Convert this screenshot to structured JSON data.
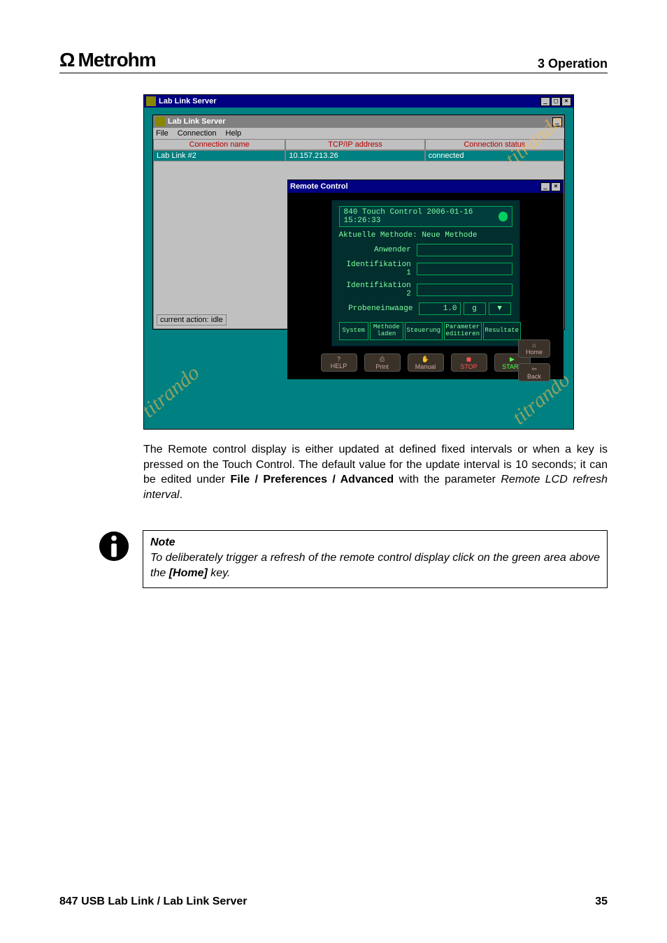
{
  "header": {
    "brand": "Metrohm",
    "section": "3 Operation"
  },
  "outer": {
    "title": "Lab Link Server"
  },
  "inner": {
    "title": "Lab Link Server",
    "menu": [
      "File",
      "Connection",
      "Help"
    ],
    "headers": [
      "Connection name",
      "TCP/IP address",
      "Connection status"
    ],
    "row": [
      "Lab Link #2",
      "10.157.213.26",
      "connected"
    ],
    "status": "current action:   idle"
  },
  "remote": {
    "title": "Remote Control",
    "top": "840 Touch Control   2006-01-16 15:26:33",
    "line2": "Aktuelle Methode: Neue Methode",
    "labels": {
      "anwender": "Anwender",
      "id1": "Identifikation 1",
      "id2": "Identifikation 2",
      "mass": "Probeneinwaage",
      "mass_val": "1.0",
      "mass_unit": "g"
    },
    "btns": [
      "System",
      "Methode laden",
      "Steuerung",
      "Parameter editieren",
      "Resultate"
    ],
    "side": {
      "home": "Home",
      "back": "Back"
    },
    "bottom": [
      "HELP",
      "Print",
      "Manual",
      "STOP",
      "START"
    ]
  },
  "para1a": "The Remote control display is either updated at defined fixed intervals or when a key is pressed on the Touch Control. The default value for the update interval is 10 seconds; it can be edited under ",
  "para1b": "File / Preferences / Advanced",
  "para1c": " with the parameter ",
  "para1d": "Remote LCD refresh interval",
  "para1e": ".",
  "note_title": "Note",
  "note_a": "To deliberately trigger a refresh of the remote control display click on the green area above the ",
  "note_b": "[Home]",
  "note_c": " key.",
  "footer": {
    "left": "847 USB Lab Link / Lab Link Server",
    "right": "35"
  }
}
